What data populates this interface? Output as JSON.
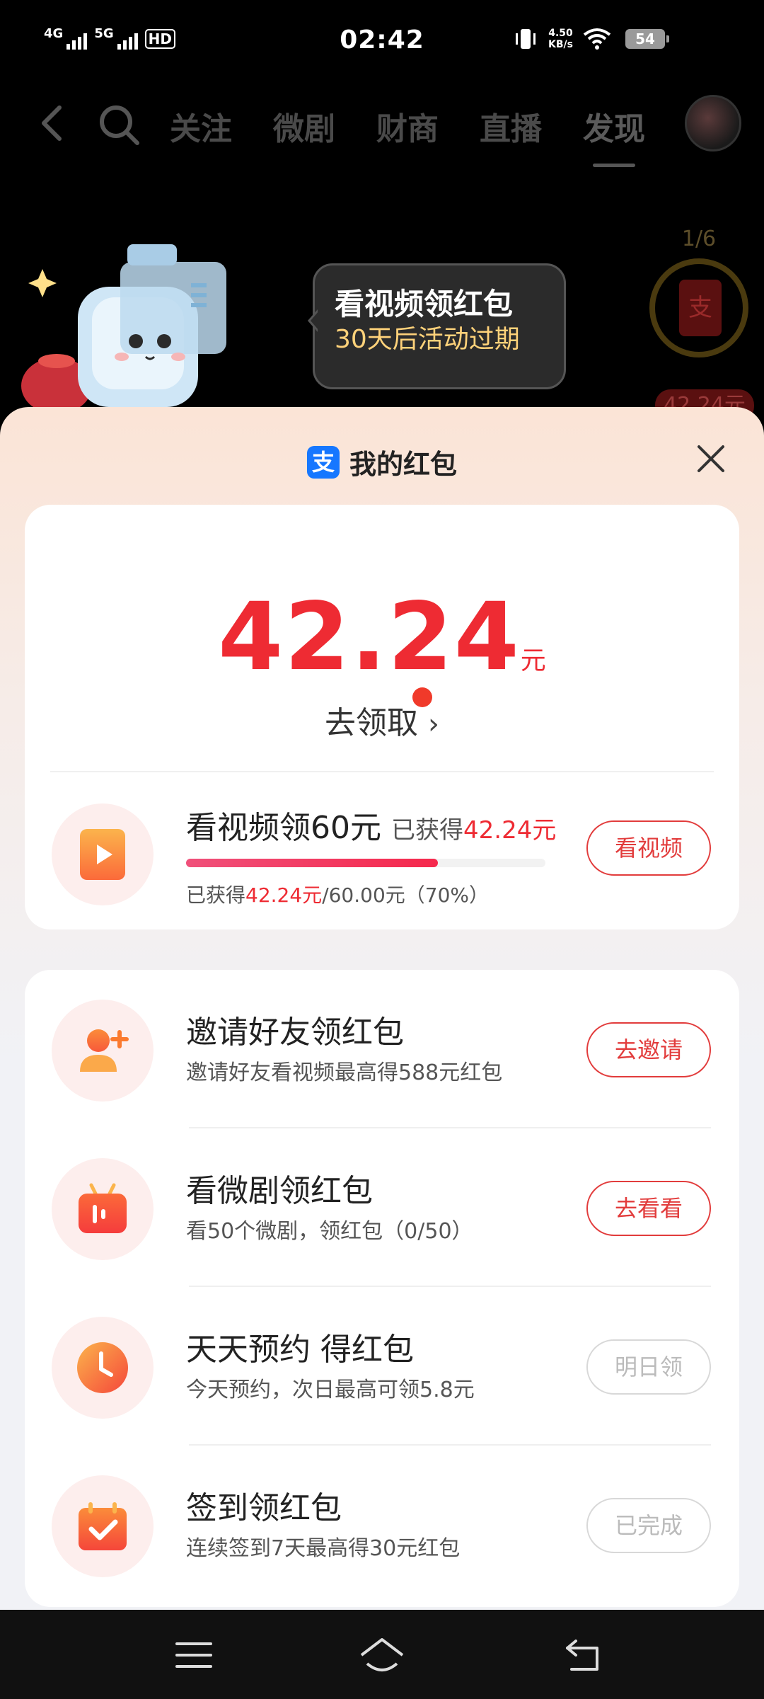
{
  "status_bar": {
    "sig1_label": "4G",
    "sig2_label": "5G",
    "hd_label": "HD",
    "time": "02:42",
    "speed_value": "4.50",
    "speed_unit": "KB/s",
    "battery": "54"
  },
  "top_nav": {
    "tabs": [
      {
        "label": "关注"
      },
      {
        "label": "微剧"
      },
      {
        "label": "财商"
      },
      {
        "label": "直播"
      },
      {
        "label": "发现"
      }
    ],
    "active_tab": "发现"
  },
  "banner": {
    "bubble_title": "看视频领红包",
    "bubble_subtitle": "30天后活动过期",
    "progress_count": "1/6",
    "widget_amount": "42.24元",
    "envelope_char": "支"
  },
  "sheet": {
    "logo_char": "支",
    "title": "我的红包",
    "balance": "42.24",
    "balance_unit": "元",
    "claim_label": "去领取",
    "video_task": {
      "title": "看视频领60元",
      "earned_prefix": "已获得",
      "earned_value": "42.24元",
      "progress_prefix": "已获得",
      "progress_value": "42.24元",
      "progress_suffix": "/60.00元（70%）",
      "progress_fraction": 0.7,
      "button": "看视频"
    },
    "tasks": [
      {
        "title": "邀请好友领红包",
        "subtitle": "邀请好友看视频最高得588元红包",
        "button": "去邀请",
        "enabled": true,
        "icon": "add-person-icon"
      },
      {
        "title": "看微剧领红包",
        "subtitle": "看50个微剧，领红包（0/50）",
        "button": "去看看",
        "enabled": true,
        "icon": "tv-icon"
      },
      {
        "title": "天天预约 得红包",
        "subtitle": "今天预约，次日最高可领5.8元",
        "button": "明日领",
        "enabled": false,
        "icon": "clock-icon"
      },
      {
        "title": "签到领红包",
        "subtitle": "连续签到7天最高得30元红包",
        "button": "已完成",
        "enabled": false,
        "icon": "calendar-check-icon"
      }
    ]
  },
  "colors": {
    "accent_red": "#ee2b33",
    "alipay_blue": "#1677ff",
    "icon_orange": "#fb7a2e"
  }
}
